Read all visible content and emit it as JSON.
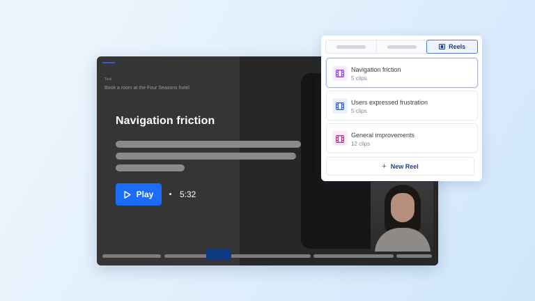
{
  "player": {
    "tiny_label": "Task",
    "task_text": "Book a room at the Four Seasons hotel",
    "title": "Navigation friction",
    "play_label": "Play",
    "duration": "5:32"
  },
  "panel": {
    "tabs": [
      {
        "label": "",
        "active": false
      },
      {
        "label": "",
        "active": false
      },
      {
        "label": "Reels",
        "active": true
      }
    ],
    "reels": [
      {
        "name": "Navigation friction",
        "clips": "5 clips",
        "icon": "film-icon",
        "icon_color": "#9b3fd0",
        "icon_bg": "#f6eefc",
        "selected": true
      },
      {
        "name": "Users expressed frustration",
        "clips": "5 clips",
        "icon": "film-icon",
        "icon_color": "#2b63d9",
        "icon_bg": "#eaf1fe",
        "selected": false
      },
      {
        "name": "General improvements",
        "clips": "12 clips",
        "icon": "film-icon",
        "icon_color": "#b0359f",
        "icon_bg": "#fbeef8",
        "selected": false
      }
    ],
    "new_reel_label": "New Reel"
  },
  "colors": {
    "accent": "#1a6dfa",
    "panel_accent": "#1f3e8a"
  }
}
